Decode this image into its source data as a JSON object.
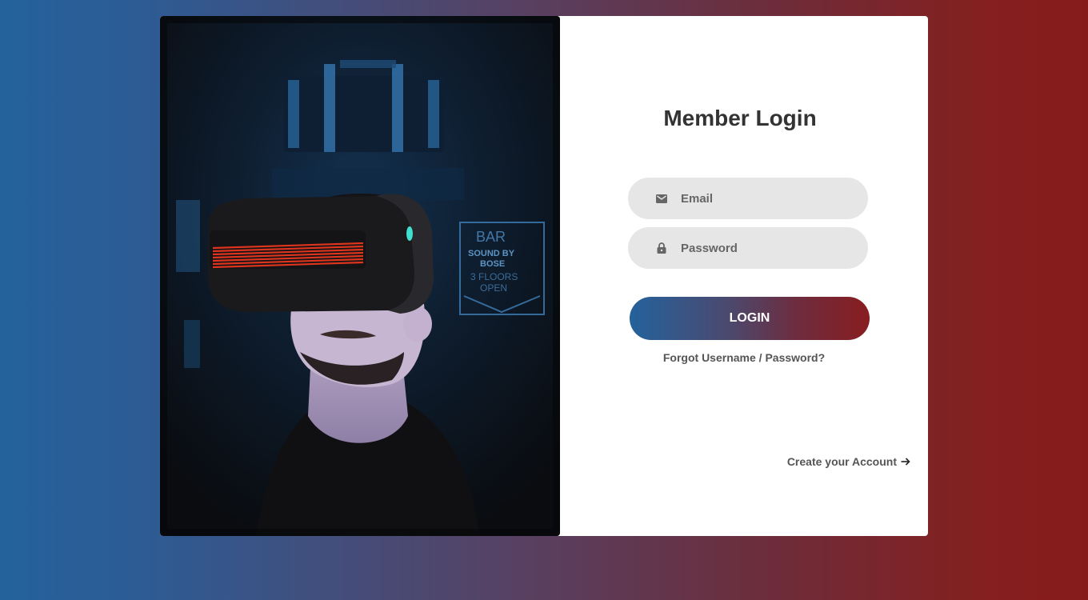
{
  "login": {
    "title": "Member Login",
    "email_placeholder": "Email",
    "password_placeholder": "Password",
    "login_label": "LOGIN",
    "forgot_label": "Forgot Username / Password?",
    "create_label": "Create your Account"
  },
  "icons": {
    "email": "mail-icon",
    "password": "lock-icon",
    "create": "arrow-right-icon"
  },
  "colors": {
    "gradient_start": "#24629c",
    "gradient_end": "#861b1b",
    "field_bg": "#e6e6e6",
    "title": "#333333"
  }
}
